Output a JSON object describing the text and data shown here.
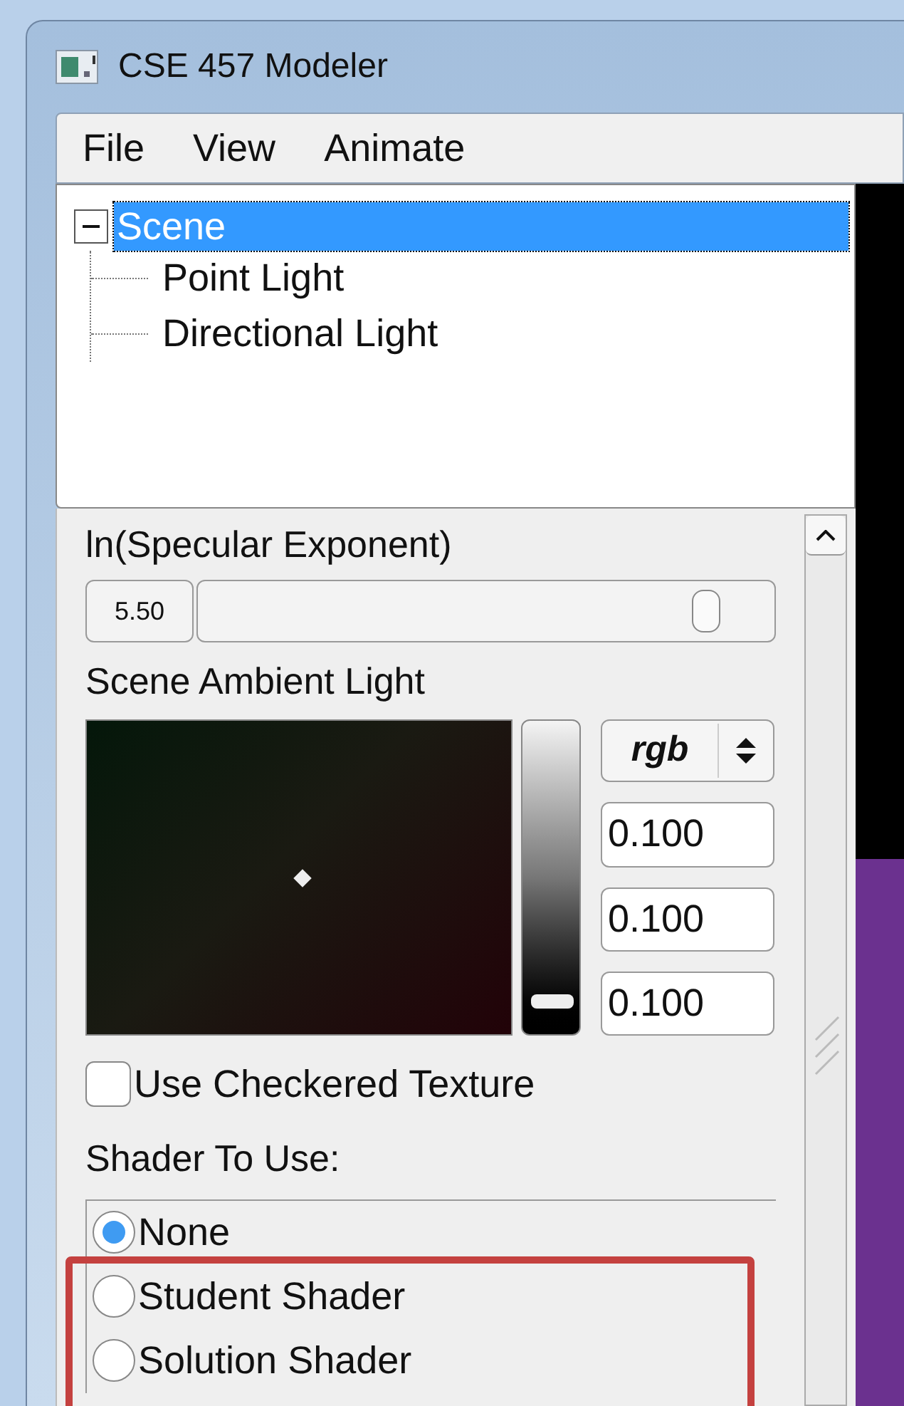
{
  "window": {
    "title": "CSE 457 Modeler"
  },
  "menu": [
    "File",
    "View",
    "Animate"
  ],
  "tree": {
    "label": "Scene",
    "selected": true,
    "expanded": true,
    "children": [
      {
        "label": "Point Light",
        "selected": false
      },
      {
        "label": "Directional Light",
        "selected": false
      }
    ]
  },
  "specular": {
    "label": "ln(Specular Exponent)",
    "value": "5.50",
    "level": 0.9
  },
  "ambient": {
    "label": "Scene Ambient Light",
    "mode": "rgb",
    "brightness": {
      "level": 0.08
    },
    "values": [
      "0.100",
      "0.100",
      "0.100"
    ]
  },
  "checkered": {
    "label": "Use Checkered Texture",
    "checked": false
  },
  "shader": {
    "label": "Shader To Use:",
    "options": [
      {
        "label": "None",
        "selected": true
      },
      {
        "label": "Student Shader",
        "selected": false
      },
      {
        "label": "Solution Shader",
        "selected": false
      }
    ]
  }
}
